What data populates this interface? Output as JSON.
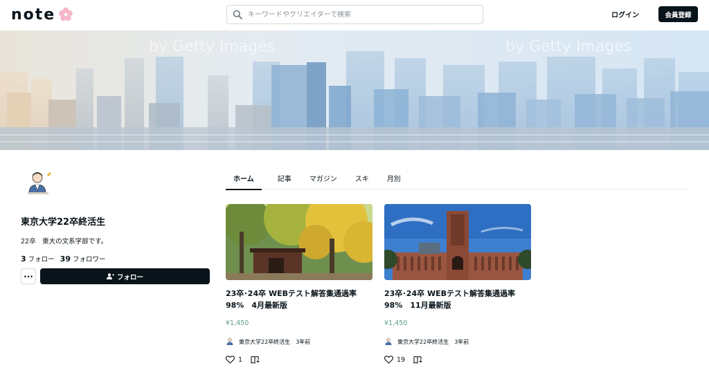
{
  "header": {
    "logo_text": "note",
    "search_placeholder": "キーワードやクリエイターで検索",
    "login_label": "ログイン",
    "signup_label": "会員登録"
  },
  "banner": {
    "watermark_left": "by Getty Images",
    "watermark_right": "by Getty Images"
  },
  "profile": {
    "name": "東京大学22卒終活生",
    "bio": "22卒　東大の文系学部です。",
    "following_count": "3",
    "following_label": "フォロー",
    "followers_count": "39",
    "followers_label": "フォロワー",
    "more_label": "···",
    "follow_button_label": "フォロー"
  },
  "tabs": [
    {
      "label": "ホーム",
      "active": true
    },
    {
      "label": "記事",
      "active": false
    },
    {
      "label": "マガジン",
      "active": false
    },
    {
      "label": "スキ",
      "active": false
    },
    {
      "label": "月別",
      "active": false
    }
  ],
  "articles": [
    {
      "title_line1": "23卒･24卒 WEBテスト解答集通過率",
      "title_line2": "98%　4月最新版",
      "price": "¥1,450",
      "author": "東京大学22卒終活生",
      "ago": "3年前",
      "likes": "1",
      "image": "autumn-gate-photo"
    },
    {
      "title_line1": "23卒･24卒 WEBテスト解答集通過率",
      "title_line2": "98%　11月最新版",
      "price": "¥1,450",
      "author": "東京大学22卒終活生",
      "ago": "3年前",
      "likes": "19",
      "image": "yasuda-auditorium-photo"
    }
  ],
  "colors": {
    "primary": "#08131a",
    "price": "#5b9a8b",
    "border": "#d4d7d9",
    "logo_flower": "#f6b6c8"
  }
}
